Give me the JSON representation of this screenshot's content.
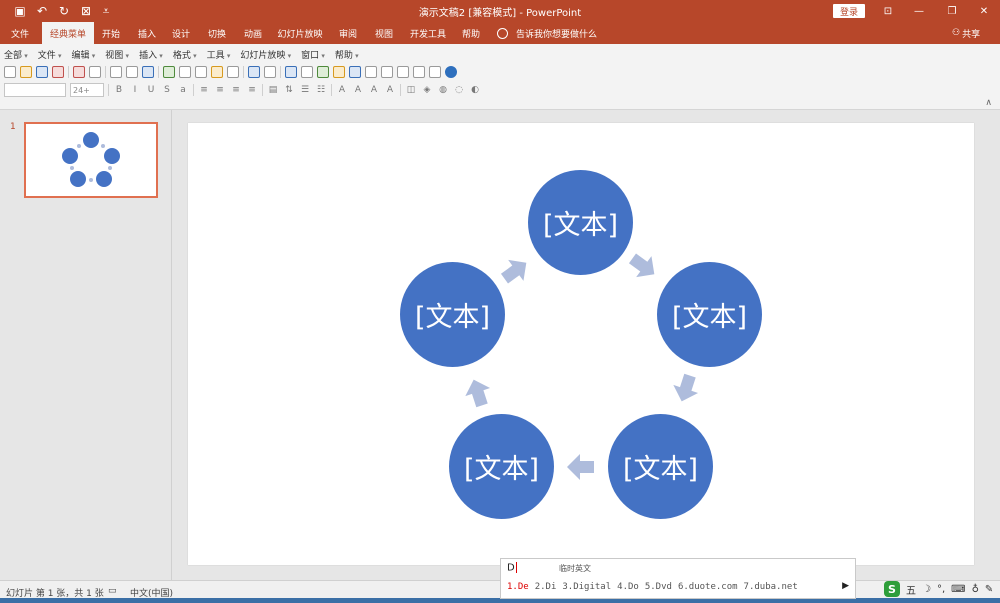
{
  "app": {
    "title": "演示文稿2 [兼容模式]  -  PowerPoint",
    "login_label": "登录",
    "share_label": "共享"
  },
  "ribbon_tabs": [
    {
      "label": "文件",
      "active": false
    },
    {
      "label": "经典菜单",
      "active": true
    },
    {
      "label": "开始",
      "active": false
    },
    {
      "label": "插入",
      "active": false
    },
    {
      "label": "设计",
      "active": false
    },
    {
      "label": "切换",
      "active": false
    },
    {
      "label": "动画",
      "active": false
    },
    {
      "label": "幻灯片放映",
      "active": false
    },
    {
      "label": "审阅",
      "active": false
    },
    {
      "label": "视图",
      "active": false
    },
    {
      "label": "开发工具",
      "active": false
    },
    {
      "label": "帮助",
      "active": false
    }
  ],
  "tell_me": "告诉我你想要做什么",
  "classic_menu": [
    "全部",
    "文件",
    "编辑",
    "视图",
    "插入",
    "格式",
    "工具",
    "幻灯片放映",
    "窗口",
    "帮助"
  ],
  "font_size": "24+",
  "thumbnail": {
    "slide_number": "1"
  },
  "slide": {
    "circles": [
      {
        "label": "[文本]"
      },
      {
        "label": "[文本]"
      },
      {
        "label": "[文本]"
      },
      {
        "label": "[文本]"
      },
      {
        "label": "[文本]"
      }
    ],
    "colors": {
      "circle": "#4472c4",
      "arrow": "#aebcdc"
    }
  },
  "ime": {
    "input": "D",
    "hint": "临时英文",
    "candidates": [
      "1.De",
      "2.Di",
      "3.Digital",
      "4.Do",
      "5.Dvd",
      "6.duote.com",
      "7.duba.net"
    ]
  },
  "status": {
    "slide_info": "幻灯片 第 1 张，共 1 张",
    "language": "中文(中国)"
  },
  "tray": {
    "ime_mode": "五"
  }
}
